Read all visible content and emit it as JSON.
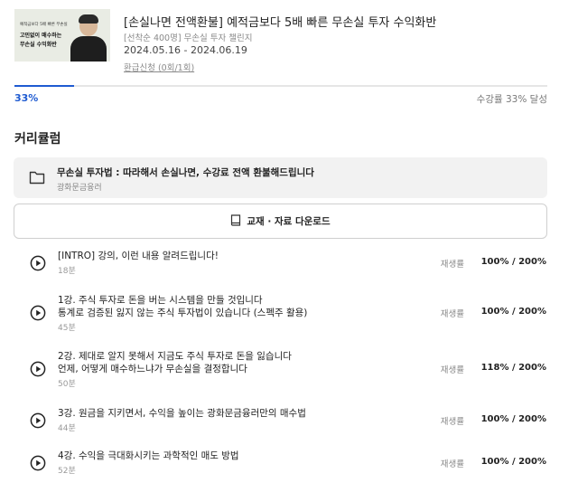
{
  "course": {
    "title": "[손실나면 전액환불] 예적금보다 5배 빠른 무손실 투자 수익화반",
    "subtitle": "[선착순 400명] 무손실 투자 챌린지",
    "dates": "2024.05.16 - 2024.06.19",
    "refund_link": "환급신청 (0회/1회)",
    "thumbnail": {
      "line1": "예적금보다 5배 빠른 무손실",
      "line2": "고민없이 매수하는",
      "line3": "무손실 수익화반"
    }
  },
  "progress": {
    "percent_label": "33%",
    "value": 33,
    "status_text": "수강률 33% 달성",
    "color": "#1f5bd1"
  },
  "curriculum": {
    "heading": "커리큘럼",
    "chapter": {
      "icon": "folder-icon",
      "title": "무손실 투자법 : 따라해서 손실나면, 수강료 전액 환불해드립니다",
      "author": "광화문금융러"
    },
    "download_label": "교재 · 자료 다운로드",
    "download_icon": "book-icon",
    "lessons": [
      {
        "line1": "[INTRO] 강의, 이런 내용 알려드립니다!",
        "line2": "",
        "duration": "18분",
        "label": "재생률",
        "rate": "100% / 200%"
      },
      {
        "line1": "1강. 주식 투자로 돈을 버는 시스템을 만들 것입니다",
        "line2": "통계로 검증된 잃지 않는 주식 투자법이 있습니다 (스펙주 활용)",
        "duration": "45분",
        "label": "재생률",
        "rate": "100% / 200%"
      },
      {
        "line1": "2강. 제대로 알지 못해서 지금도 주식 투자로 돈을 잃습니다",
        "line2": "언제, 어떻게 매수하느냐가 무손실을 결정합니다",
        "duration": "50분",
        "label": "재생률",
        "rate": "118% / 200%"
      },
      {
        "line1": "3강. 원금을 지키면서, 수익을 높이는 광화문금융러만의 매수법",
        "line2": "",
        "duration": "44분",
        "label": "재생률",
        "rate": "100% / 200%"
      },
      {
        "line1": "4강. 수익을 극대화시키는 과학적인 매도 방법",
        "line2": "",
        "duration": "52분",
        "label": "재생률",
        "rate": "100% / 200%"
      }
    ]
  }
}
